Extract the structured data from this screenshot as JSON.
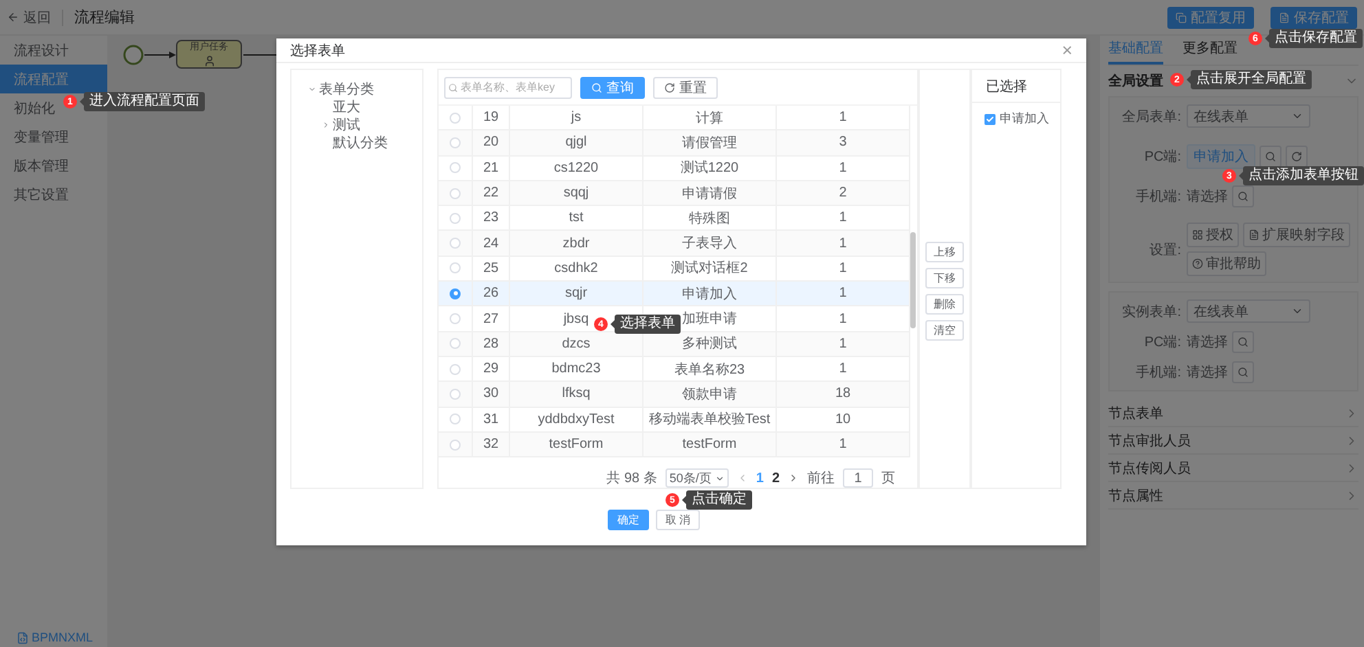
{
  "header": {
    "back": "返回",
    "title": "流程编辑",
    "buttons": [
      {
        "label": "配置复用",
        "kind": "copy"
      },
      {
        "label": "保存配置",
        "kind": "save"
      }
    ]
  },
  "sidebar": {
    "items": [
      {
        "label": "流程设计",
        "selected": false
      },
      {
        "label": "流程配置",
        "selected": true
      },
      {
        "label": "初始化",
        "selected": false
      },
      {
        "label": "变量管理",
        "selected": false
      },
      {
        "label": "版本管理",
        "selected": false
      },
      {
        "label": "其它设置",
        "selected": false
      }
    ],
    "footer": "BPMNXML"
  },
  "diagram": {
    "task": "用户任务"
  },
  "settings": {
    "tabs": [
      {
        "label": "基础配置",
        "selected": true
      },
      {
        "label": "更多配置",
        "selected": false
      }
    ],
    "global": {
      "title": "全局设置",
      "expanded": true,
      "groups": [
        [
          {
            "label": "全局表单:",
            "kind": "select",
            "value": "在线表单"
          },
          {
            "label": "PC端:",
            "kind": "picked",
            "value": "申请加入"
          },
          {
            "label": "手机端:",
            "kind": "empty",
            "value": "请选择"
          },
          {
            "label": "设置:",
            "kind": "actions",
            "actions": [
              "授权",
              "扩展映射字段",
              "审批帮助"
            ]
          }
        ],
        [
          {
            "label": "实例表单:",
            "kind": "select",
            "value": "在线表单"
          },
          {
            "label": "PC端:",
            "kind": "empty",
            "value": "请选择"
          },
          {
            "label": "手机端:",
            "kind": "empty",
            "value": "请选择"
          }
        ]
      ]
    },
    "nodes": [
      {
        "label": "节点表单",
        "expanded": false
      },
      {
        "label": "节点审批人员",
        "expanded": false
      },
      {
        "label": "节点传阅人员",
        "expanded": false
      },
      {
        "label": "节点属性",
        "expanded": false
      }
    ]
  },
  "dialog": {
    "title": "选择表单",
    "close": "×",
    "tree": [
      {
        "label": "表单分类",
        "expanded": true,
        "children": [
          {
            "label": "亚大"
          },
          {
            "label": "测试",
            "expanded": false
          },
          {
            "label": "默认分类"
          }
        ]
      }
    ],
    "search": {
      "placeholder": "表单名称、表单key"
    },
    "buttons": [
      {
        "label": "查询",
        "kind": "primary"
      },
      {
        "label": "重置",
        "kind": "default"
      }
    ],
    "rows": [
      {
        "no": "19",
        "key": "js",
        "name": "计算",
        "version": "1",
        "selected": false
      },
      {
        "no": "20",
        "key": "qjgl",
        "name": "请假管理",
        "version": "3",
        "selected": false
      },
      {
        "no": "21",
        "key": "cs1220",
        "name": "测试1220",
        "version": "1",
        "selected": false
      },
      {
        "no": "22",
        "key": "sqqj",
        "name": "申请请假",
        "version": "2",
        "selected": false
      },
      {
        "no": "23",
        "key": "tst",
        "name": "特殊图",
        "version": "1",
        "selected": false
      },
      {
        "no": "24",
        "key": "zbdr",
        "name": "子表导入",
        "version": "1",
        "selected": false
      },
      {
        "no": "25",
        "key": "csdhk2",
        "name": "测试对话框2",
        "version": "1",
        "selected": false
      },
      {
        "no": "26",
        "key": "sqjr",
        "name": "申请加入",
        "version": "1",
        "selected": true
      },
      {
        "no": "27",
        "key": "jbsq",
        "name": "加班申请",
        "version": "1",
        "selected": false
      },
      {
        "no": "28",
        "key": "dzcs",
        "name": "多种测试",
        "version": "1",
        "selected": false
      },
      {
        "no": "29",
        "key": "bdmc23",
        "name": "表单名称23",
        "version": "1",
        "selected": false
      },
      {
        "no": "30",
        "key": "lfksq",
        "name": "领款申请",
        "version": "18",
        "selected": false
      },
      {
        "no": "31",
        "key": "yddbdxyTest",
        "name": "移动端表单校验Test",
        "version": "10",
        "selected": false
      },
      {
        "no": "32",
        "key": "testForm",
        "name": "testForm",
        "version": "1",
        "selected": false
      }
    ],
    "pagination": {
      "total": "共 98 条",
      "page_size": "50条/页",
      "pages": [
        {
          "label": "1",
          "selected": true
        },
        {
          "label": "2",
          "selected": false
        }
      ],
      "goto": "前往",
      "page_input": "1",
      "page_unit": "页"
    },
    "move_buttons": [
      "上移",
      "下移",
      "删除",
      "清空"
    ],
    "selected_panel": {
      "title": "已选择",
      "items": [
        {
          "label": "申请加入",
          "checked": true
        }
      ]
    },
    "footer": [
      {
        "label": "确定",
        "kind": "primary"
      },
      {
        "label": "取 消",
        "kind": "default"
      }
    ]
  },
  "callouts": [
    {
      "number": "1",
      "text": "进入流程配置页面"
    },
    {
      "number": "2",
      "text": "点击展开全局配置"
    },
    {
      "number": "3",
      "text": "点击添加表单按钮"
    },
    {
      "number": "4",
      "text": "选择表单"
    },
    {
      "number": "5",
      "text": "点击确定"
    },
    {
      "number": "6",
      "text": "点击保存配置"
    }
  ]
}
